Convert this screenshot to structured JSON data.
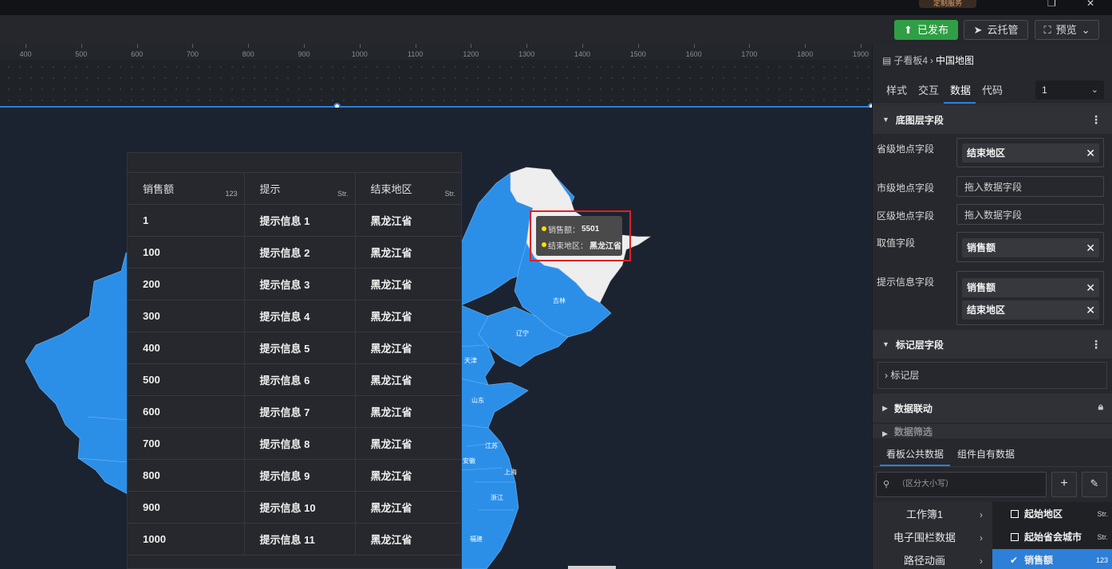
{
  "topbar": {
    "badge": "定制服务"
  },
  "toolbar": {
    "publish_label": "已发布",
    "cloud_label": "云托管",
    "preview_label": "预览"
  },
  "ruler": {
    "ticks": [
      "400",
      "500",
      "600",
      "700",
      "800",
      "900",
      "1000",
      "1100",
      "1200",
      "1300",
      "1400",
      "1500",
      "1600",
      "1700",
      "1800",
      "1900"
    ]
  },
  "table": {
    "columns": [
      {
        "name": "销售额",
        "type": "123"
      },
      {
        "name": "提示",
        "type": "Str."
      },
      {
        "name": "结束地区",
        "type": "Str."
      }
    ],
    "rows": [
      [
        "1",
        "提示信息 1",
        "黑龙江省"
      ],
      [
        "100",
        "提示信息 2",
        "黑龙江省"
      ],
      [
        "200",
        "提示信息 3",
        "黑龙江省"
      ],
      [
        "300",
        "提示信息 4",
        "黑龙江省"
      ],
      [
        "400",
        "提示信息 5",
        "黑龙江省"
      ],
      [
        "500",
        "提示信息 6",
        "黑龙江省"
      ],
      [
        "600",
        "提示信息 7",
        "黑龙江省"
      ],
      [
        "700",
        "提示信息 8",
        "黑龙江省"
      ],
      [
        "800",
        "提示信息 9",
        "黑龙江省"
      ],
      [
        "900",
        "提示信息 10",
        "黑龙江省"
      ],
      [
        "1000",
        "提示信息 11",
        "黑龙江省"
      ]
    ]
  },
  "tooltip": {
    "row1_key": "销售额：",
    "row1_val": "5501",
    "row2_key": "结束地区：",
    "row2_val": "黑龙江省"
  },
  "map": {
    "labels": {
      "jilin": "吉林",
      "liaoning": "辽宁",
      "tianjin": "天津",
      "shandong": "山东",
      "jiangsu": "江苏",
      "anhui": "安徽",
      "shanghai": "上海",
      "zhejiang": "浙江",
      "fujian": "福建"
    },
    "colors": {
      "region": "#2b8fe8",
      "highlight": "#eeeeee",
      "border": "#78b8f0"
    }
  },
  "panel": {
    "breadcrumb_parent": "子看板4",
    "breadcrumb_current": "中国地图",
    "tabs": [
      "样式",
      "交互",
      "数据",
      "代码"
    ],
    "active_tab": "数据",
    "select_value": "1",
    "sections": {
      "base": "底图层字段",
      "marker": "标记层字段",
      "linkage": "数据联动",
      "filter": "数据筛选"
    },
    "fields": {
      "province_label": "省级地点字段",
      "province_chip": "结束地区",
      "city_label": "市级地点字段",
      "city_placeholder": "拖入数据字段",
      "district_label": "区级地点字段",
      "district_placeholder": "拖入数据字段",
      "value_label": "取值字段",
      "value_chip": "销售额",
      "tip_label": "提示信息字段",
      "tip_chip1": "销售额",
      "tip_chip2": "结束地区"
    },
    "marker_layer": "标记层",
    "data_tabs": [
      "看板公共数据",
      "组件自有数据"
    ],
    "search_placeholder": "（区分大小写）",
    "tree": [
      "工作簿1",
      "电子围栏数据",
      "路径动画"
    ],
    "field_list": [
      {
        "name": "起始地区",
        "type": "Str.",
        "checked": false
      },
      {
        "name": "起始省会城市",
        "type": "Str.",
        "checked": false
      },
      {
        "name": "销售额",
        "type": "123",
        "checked": true
      }
    ]
  }
}
